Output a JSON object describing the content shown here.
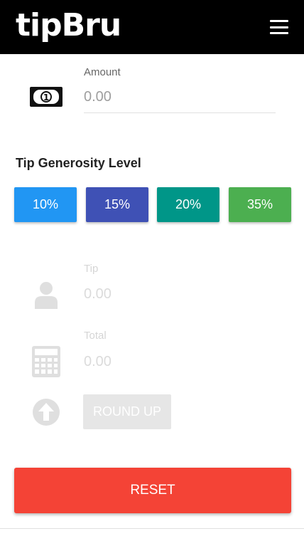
{
  "app": {
    "logo_text": "tipBru"
  },
  "header": {
    "menu_icon": "hamburger-menu-icon"
  },
  "amount": {
    "label": "Amount",
    "placeholder": "0.00",
    "icon": "banknote-icon"
  },
  "tip_section": {
    "title": "Tip Generosity Level",
    "options": [
      {
        "label": "10%",
        "color": "#2196f3"
      },
      {
        "label": "15%",
        "color": "#3f51b5"
      },
      {
        "label": "20%",
        "color": "#009688"
      },
      {
        "label": "35%",
        "color": "#4caf50"
      }
    ]
  },
  "tip": {
    "label": "Tip",
    "value": "0.00",
    "icon": "person-icon"
  },
  "total": {
    "label": "Total",
    "value": "0.00",
    "icon": "calculator-icon"
  },
  "round_up": {
    "label": "ROUND UP",
    "icon": "arrow-up-circle-icon"
  },
  "reset": {
    "label": "RESET",
    "color": "#f44336"
  }
}
